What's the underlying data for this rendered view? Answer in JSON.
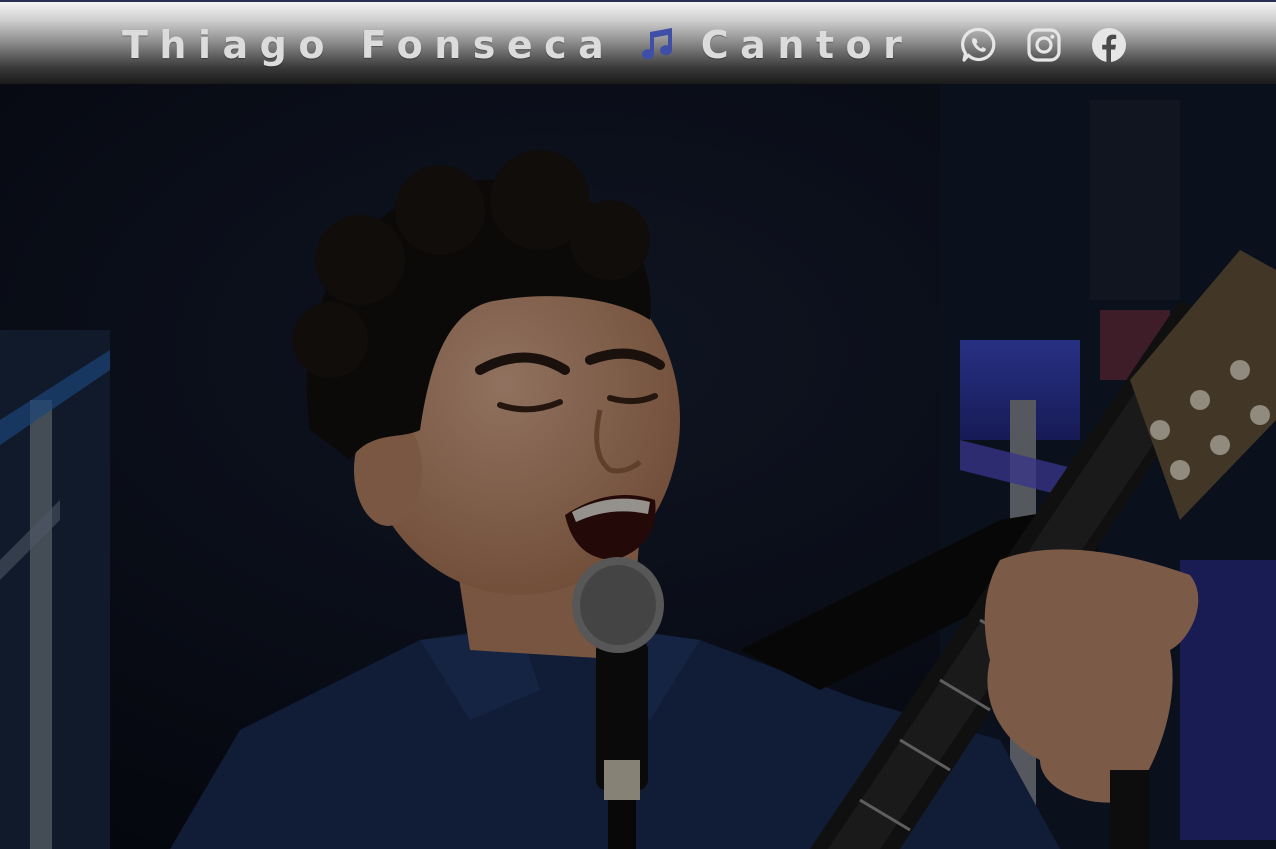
{
  "header": {
    "title_first": "Thiago Fonseca",
    "title_icon": "music-note-icon",
    "title_second": "Cantor",
    "title_icon_color": "#3f4fa8"
  },
  "social": [
    {
      "name": "WhatsApp",
      "icon": "whatsapp-icon"
    },
    {
      "name": "Instagram",
      "icon": "instagram-icon"
    },
    {
      "name": "Facebook",
      "icon": "facebook-icon"
    }
  ],
  "hero": {
    "image": "singer-with-guitar-photo"
  },
  "colors": {
    "header_text": "#dcdcdc",
    "icon": "#e6e6e6",
    "background": "#0d1120",
    "shirt": "#1c2e5a",
    "stage_light": "#3a3fd0"
  }
}
